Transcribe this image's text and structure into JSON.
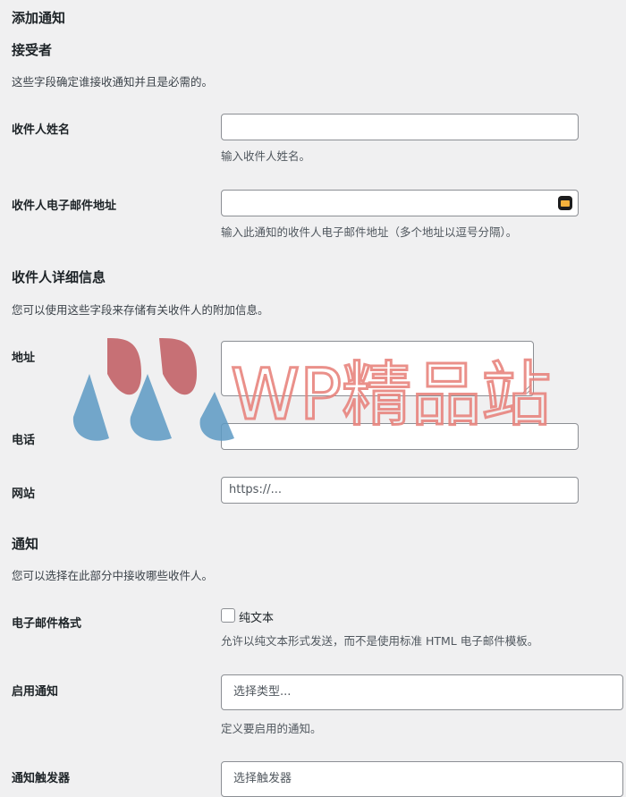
{
  "page": {
    "title": "添加通知"
  },
  "recipient": {
    "heading": "接受者",
    "description": "这些字段确定谁接收通知并且是必需的。",
    "name_label": "收件人姓名",
    "name_help": "输入收件人姓名。",
    "email_label": "收件人电子邮件地址",
    "email_help": "输入此通知的收件人电子邮件地址（多个地址以逗号分隔）。"
  },
  "details": {
    "heading": "收件人详细信息",
    "description": "您可以使用这些字段来存储有关收件人的附加信息。",
    "address_label": "地址",
    "phone_label": "电话",
    "website_label": "网站",
    "website_placeholder": "https://..."
  },
  "notification": {
    "heading": "通知",
    "description": "您可以选择在此部分中接收哪些收件人。",
    "format_label": "电子邮件格式",
    "plain_text_label": "纯文本",
    "format_help": "允许以纯文本形式发送，而不是使用标准 HTML 电子邮件模板。",
    "enable_label": "启用通知",
    "enable_placeholder": "选择类型...",
    "enable_help": "定义要启用的通知。",
    "trigger_label": "通知触发器",
    "trigger_placeholder": "选择触发器"
  },
  "watermark": {
    "text": "WP精品站"
  },
  "colors": {
    "watermark_text": "#e8847e",
    "drop_blue": "#5d9ac4",
    "drop_red": "#c05a60"
  }
}
